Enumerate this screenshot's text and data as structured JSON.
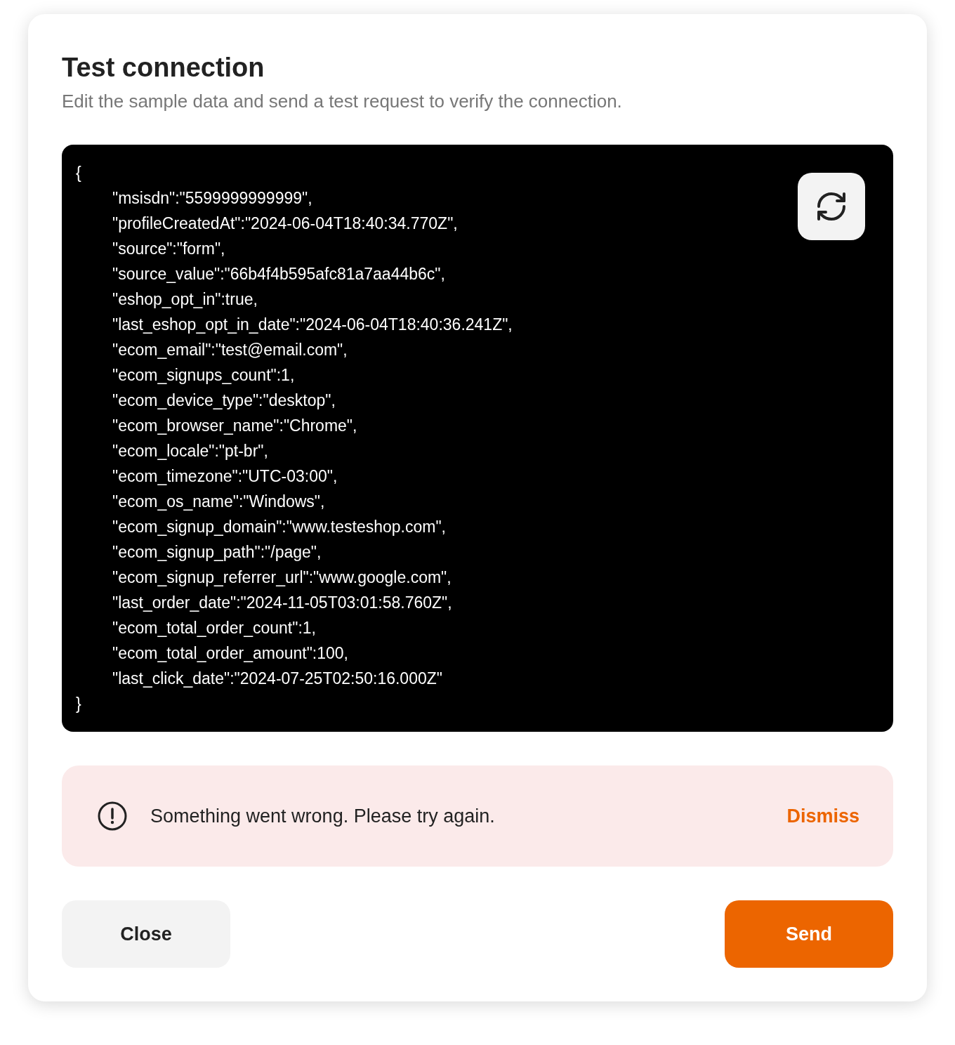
{
  "dialog": {
    "title": "Test connection",
    "subtitle": "Edit the sample data and send a test request to verify the connection."
  },
  "code": {
    "lines": [
      {
        "kind": "brace",
        "text": "{"
      },
      {
        "kind": "entry",
        "text": "\"msisdn\":\"5599999999999\","
      },
      {
        "kind": "entry",
        "text": "\"profileCreatedAt\":\"2024-06-04T18:40:34.770Z\","
      },
      {
        "kind": "entry",
        "text": "\"source\":\"form\","
      },
      {
        "kind": "entry",
        "text": "\"source_value\":\"66b4f4b595afc81a7aa44b6c\","
      },
      {
        "kind": "entry",
        "text": "\"eshop_opt_in\":true,"
      },
      {
        "kind": "entry",
        "text": "\"last_eshop_opt_in_date\":\"2024-06-04T18:40:36.241Z\","
      },
      {
        "kind": "entry",
        "text": "\"ecom_email\":\"test@email.com\","
      },
      {
        "kind": "entry",
        "text": "\"ecom_signups_count\":1,"
      },
      {
        "kind": "entry",
        "text": "\"ecom_device_type\":\"desktop\","
      },
      {
        "kind": "entry",
        "text": "\"ecom_browser_name\":\"Chrome\","
      },
      {
        "kind": "entry",
        "text": "\"ecom_locale\":\"pt-br\","
      },
      {
        "kind": "entry",
        "text": "\"ecom_timezone\":\"UTC-03:00\","
      },
      {
        "kind": "entry",
        "text": "\"ecom_os_name\":\"Windows\","
      },
      {
        "kind": "entry",
        "text": "\"ecom_signup_domain\":\"www.testeshop.com\","
      },
      {
        "kind": "entry",
        "text": "\"ecom_signup_path\":\"/page\","
      },
      {
        "kind": "entry",
        "text": "\"ecom_signup_referrer_url\":\"www.google.com\","
      },
      {
        "kind": "entry",
        "text": "\"last_order_date\":\"2024-11-05T03:01:58.760Z\","
      },
      {
        "kind": "entry",
        "text": "\"ecom_total_order_count\":1,"
      },
      {
        "kind": "entry",
        "text": "\"ecom_total_order_amount\":100,"
      },
      {
        "kind": "entry",
        "text": "\"last_click_date\":\"2024-07-25T02:50:16.000Z\""
      },
      {
        "kind": "brace",
        "text": "}"
      }
    ]
  },
  "error": {
    "message": "Something went wrong. Please try again.",
    "action": "Dismiss"
  },
  "buttons": {
    "close": "Close",
    "send": "Send"
  }
}
